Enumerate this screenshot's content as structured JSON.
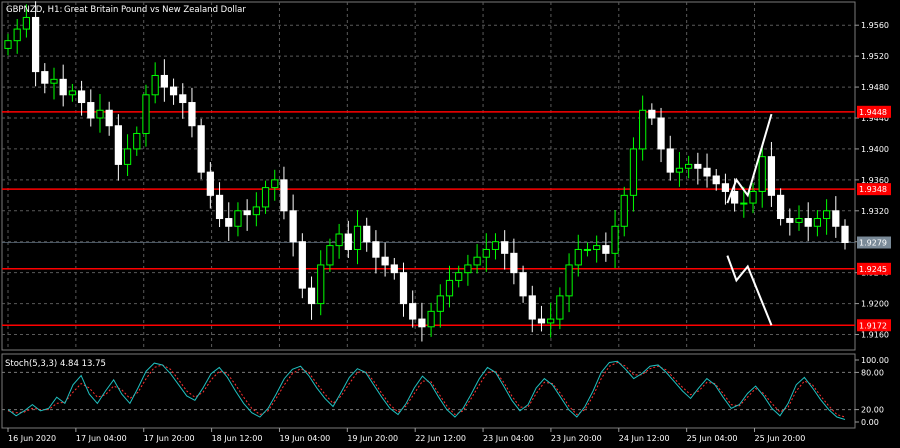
{
  "header": {
    "symbol": "GBPNZD, H1:",
    "description": "Great Britain Pound vs New Zealand Dollar"
  },
  "indicator": {
    "label": "Stoch(5,3,3) 4.84 13.75",
    "main_color": "#20c0c0",
    "signal_color": "#ff3030",
    "levels": [
      20,
      80
    ],
    "yticks": [
      {
        "label": "100.00",
        "value": 100
      },
      {
        "label": "80.00",
        "value": 80
      },
      {
        "label": "20.00",
        "value": 20
      },
      {
        "label": "0.00",
        "value": 0
      }
    ],
    "main": [
      20,
      10,
      18,
      28,
      18,
      22,
      40,
      30,
      60,
      75,
      45,
      30,
      50,
      68,
      45,
      30,
      55,
      82,
      95,
      92,
      78,
      60,
      42,
      35,
      55,
      78,
      88,
      72,
      50,
      30,
      15,
      8,
      22,
      45,
      70,
      85,
      90,
      75,
      55,
      38,
      25,
      48,
      72,
      86,
      80,
      60,
      40,
      22,
      12,
      30,
      55,
      74,
      62,
      40,
      20,
      8,
      22,
      45,
      70,
      88,
      80,
      58,
      35,
      18,
      28,
      55,
      70,
      60,
      40,
      20,
      8,
      25,
      50,
      80,
      96,
      98,
      85,
      70,
      78,
      90,
      92,
      80,
      65,
      50,
      38,
      55,
      70,
      60,
      40,
      22,
      28,
      46,
      58,
      42,
      22,
      10,
      30,
      60,
      72,
      55,
      36,
      20,
      8,
      4
    ],
    "signal": [
      18,
      15,
      16,
      22,
      20,
      20,
      30,
      32,
      48,
      62,
      55,
      40,
      44,
      58,
      52,
      38,
      48,
      70,
      88,
      92,
      85,
      68,
      50,
      40,
      48,
      68,
      82,
      78,
      60,
      40,
      22,
      12,
      18,
      38,
      60,
      78,
      86,
      80,
      62,
      45,
      30,
      42,
      62,
      80,
      82,
      66,
      46,
      28,
      16,
      26,
      46,
      66,
      66,
      46,
      26,
      12,
      18,
      38,
      60,
      80,
      82,
      64,
      42,
      24,
      24,
      46,
      64,
      62,
      46,
      26,
      12,
      20,
      42,
      70,
      90,
      96,
      90,
      76,
      76,
      86,
      90,
      84,
      70,
      56,
      44,
      50,
      64,
      62,
      46,
      28,
      26,
      40,
      54,
      46,
      30,
      16,
      24,
      50,
      66,
      60,
      42,
      26,
      12,
      8
    ]
  },
  "hlines": {
    "color": "#ff0000",
    "values": [
      1.9448,
      1.9348,
      1.9245,
      1.9172
    ]
  },
  "current_price": {
    "label": "1.9279",
    "value": 1.9279,
    "color": "#7a8a98"
  },
  "scenario_arrows": {
    "color": "#ffffff",
    "up_path": [
      [
        63.6,
        1.933
      ],
      [
        64.4,
        1.936
      ],
      [
        65.4,
        1.934
      ],
      [
        67.5,
        1.9445
      ]
    ],
    "down_path": [
      [
        63.6,
        1.9262
      ],
      [
        64.4,
        1.923
      ],
      [
        65.4,
        1.9248
      ],
      [
        67.5,
        1.9172
      ]
    ]
  },
  "chart_data": {
    "type": "candlestick",
    "symbol": "GBPNZD",
    "timeframe": "H1",
    "title": "Great Britain Pound vs New Zealand Dollar",
    "bull_color": "#00ff00",
    "bear_color": "#ffffff",
    "grid": true,
    "ylim": [
      1.914,
      1.959
    ],
    "yticks": [
      {
        "label": "1.9560",
        "value": 1.956
      },
      {
        "label": "1.9520",
        "value": 1.952
      },
      {
        "label": "1.9480",
        "value": 1.948
      },
      {
        "label": "1.9440",
        "value": 1.944
      },
      {
        "label": "1.9400",
        "value": 1.94
      },
      {
        "label": "1.9360",
        "value": 1.936
      },
      {
        "label": "1.9320",
        "value": 1.932
      },
      {
        "label": "1.9280",
        "value": 1.928
      },
      {
        "label": "1.9240",
        "value": 1.924
      },
      {
        "label": "1.9200",
        "value": 1.92
      },
      {
        "label": "1.9160",
        "value": 1.916
      }
    ],
    "xticks": [
      {
        "label": "16 Jun 2020",
        "index": 0
      },
      {
        "label": "17 Jun 04:00",
        "index": 6
      },
      {
        "label": "17 Jun 20:00",
        "index": 12
      },
      {
        "label": "18 Jun 12:00",
        "index": 18
      },
      {
        "label": "19 Jun 04:00",
        "index": 24
      },
      {
        "label": "19 Jun 20:00",
        "index": 30
      },
      {
        "label": "22 Jun 12:00",
        "index": 36
      },
      {
        "label": "23 Jun 04:00",
        "index": 42
      },
      {
        "label": "23 Jun 20:00",
        "index": 48
      },
      {
        "label": "24 Jun 12:00",
        "index": 54
      },
      {
        "label": "25 Jun 04:00",
        "index": 60
      },
      {
        "label": "25 Jun 20:00",
        "index": 66
      }
    ],
    "closes": [
      1.954,
      1.9555,
      1.957,
      1.95,
      1.9485,
      1.949,
      1.947,
      1.9475,
      1.946,
      1.944,
      1.945,
      1.943,
      1.938,
      1.94,
      1.942,
      1.947,
      1.9495,
      1.948,
      1.947,
      1.946,
      1.943,
      1.937,
      1.934,
      1.931,
      1.93,
      1.932,
      1.9315,
      1.9325,
      1.935,
      1.936,
      1.932,
      1.928,
      1.922,
      1.92,
      1.925,
      1.9275,
      1.929,
      1.927,
      1.93,
      1.928,
      1.926,
      1.925,
      1.924,
      1.92,
      1.918,
      1.917,
      1.919,
      1.921,
      1.923,
      1.924,
      1.925,
      1.926,
      1.927,
      1.928,
      1.9265,
      1.924,
      1.921,
      1.918,
      1.9175,
      1.918,
      1.921,
      1.925,
      1.927,
      1.927,
      1.9275,
      1.9265,
      1.93,
      1.934,
      1.94,
      1.945,
      1.944,
      1.94,
      1.937,
      1.9375,
      1.938,
      1.9375,
      1.9365,
      1.9355,
      1.9345,
      1.933,
      1.933,
      1.9345,
      1.939,
      1.934,
      1.931,
      1.9305,
      1.931,
      1.93,
      1.931,
      1.932,
      1.93,
      1.9279
    ]
  },
  "x_view": {
    "first": 0,
    "last": 74
  }
}
